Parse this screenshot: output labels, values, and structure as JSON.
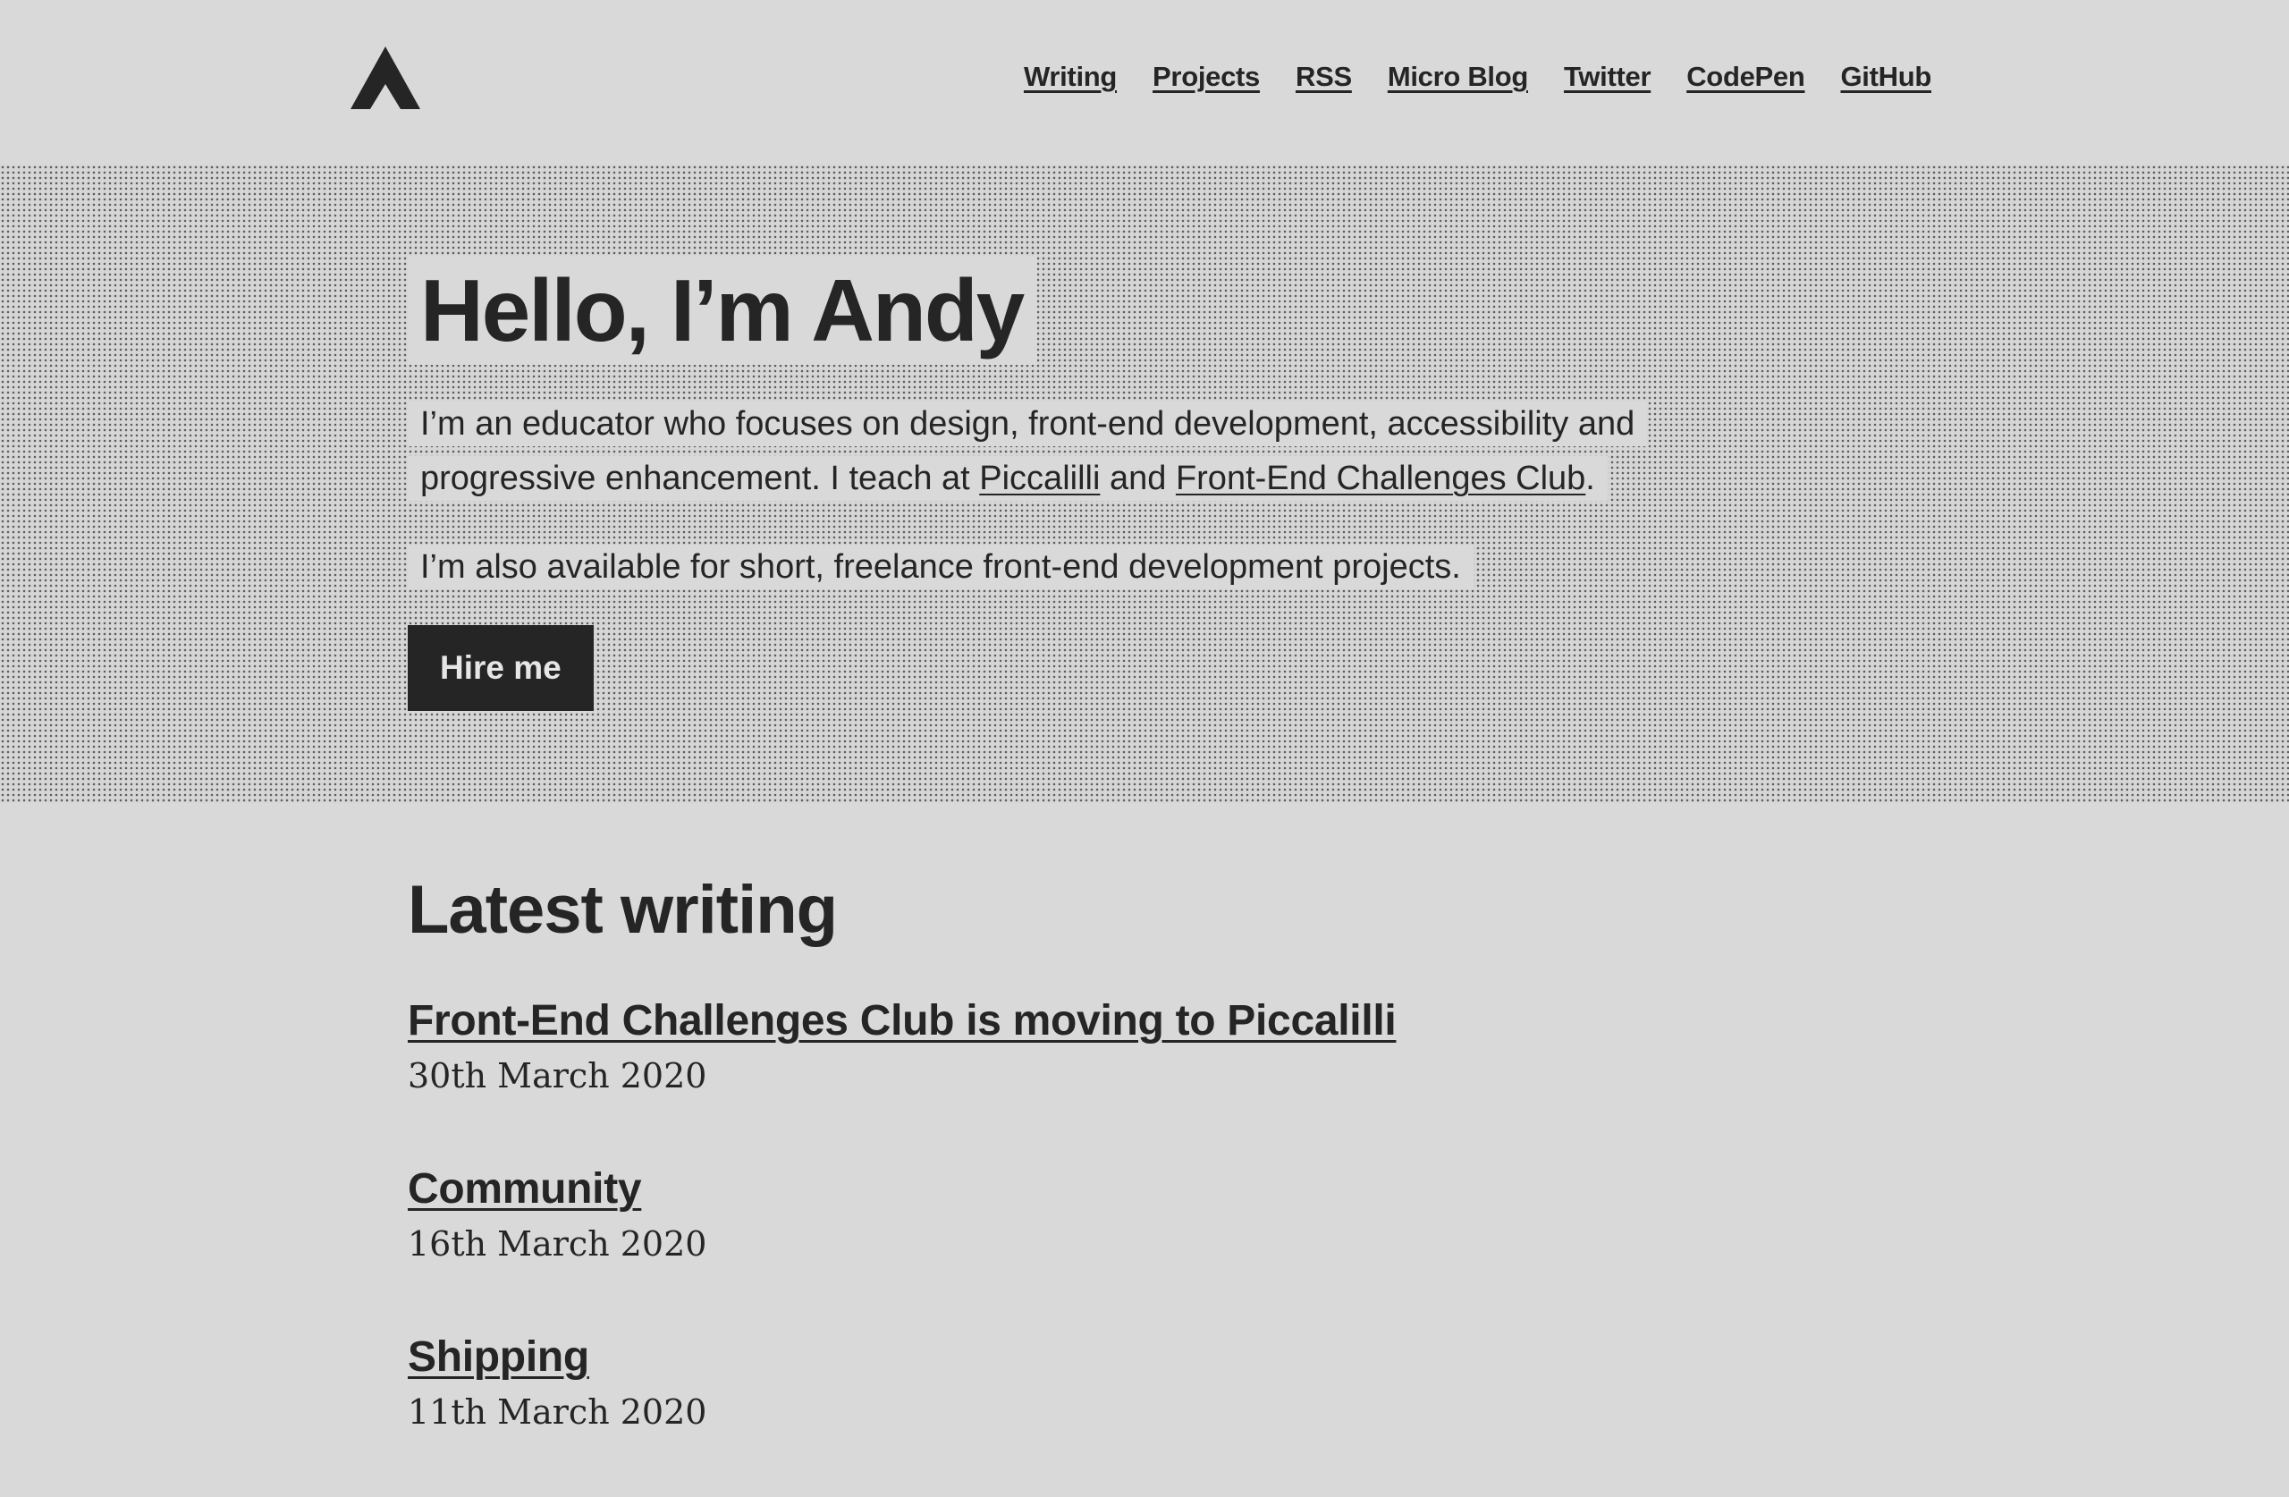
{
  "header": {
    "logo_icon": "triangle-logo-icon",
    "nav": [
      {
        "label": "Writing"
      },
      {
        "label": "Projects"
      },
      {
        "label": "RSS"
      },
      {
        "label": "Micro Blog"
      },
      {
        "label": "Twitter"
      },
      {
        "label": "CodePen"
      },
      {
        "label": "GitHub"
      }
    ]
  },
  "hero": {
    "title": "Hello, I’m Andy",
    "intro_before": "I’m an educator who focuses on design, front-end development, accessibility and progressive enhancement. I teach at ",
    "intro_link1": "Piccalilli",
    "intro_middle": " and ",
    "intro_link2": "Front-End Challenges Club",
    "intro_after": ".",
    "extra": "I’m also available for short, freelance front-end development projects.",
    "cta_label": "Hire me"
  },
  "writing": {
    "heading": "Latest writing",
    "posts": [
      {
        "title": "Front-End Challenges Club is moving to Piccalilli",
        "date": "30th March 2020"
      },
      {
        "title": "Community",
        "date": "16th March 2020"
      },
      {
        "title": "Shipping",
        "date": "11th March 2020"
      }
    ]
  },
  "colors": {
    "background": "#d9d9d9",
    "text": "#252525",
    "button_bg": "#252525",
    "button_text": "#e6e6e6"
  }
}
